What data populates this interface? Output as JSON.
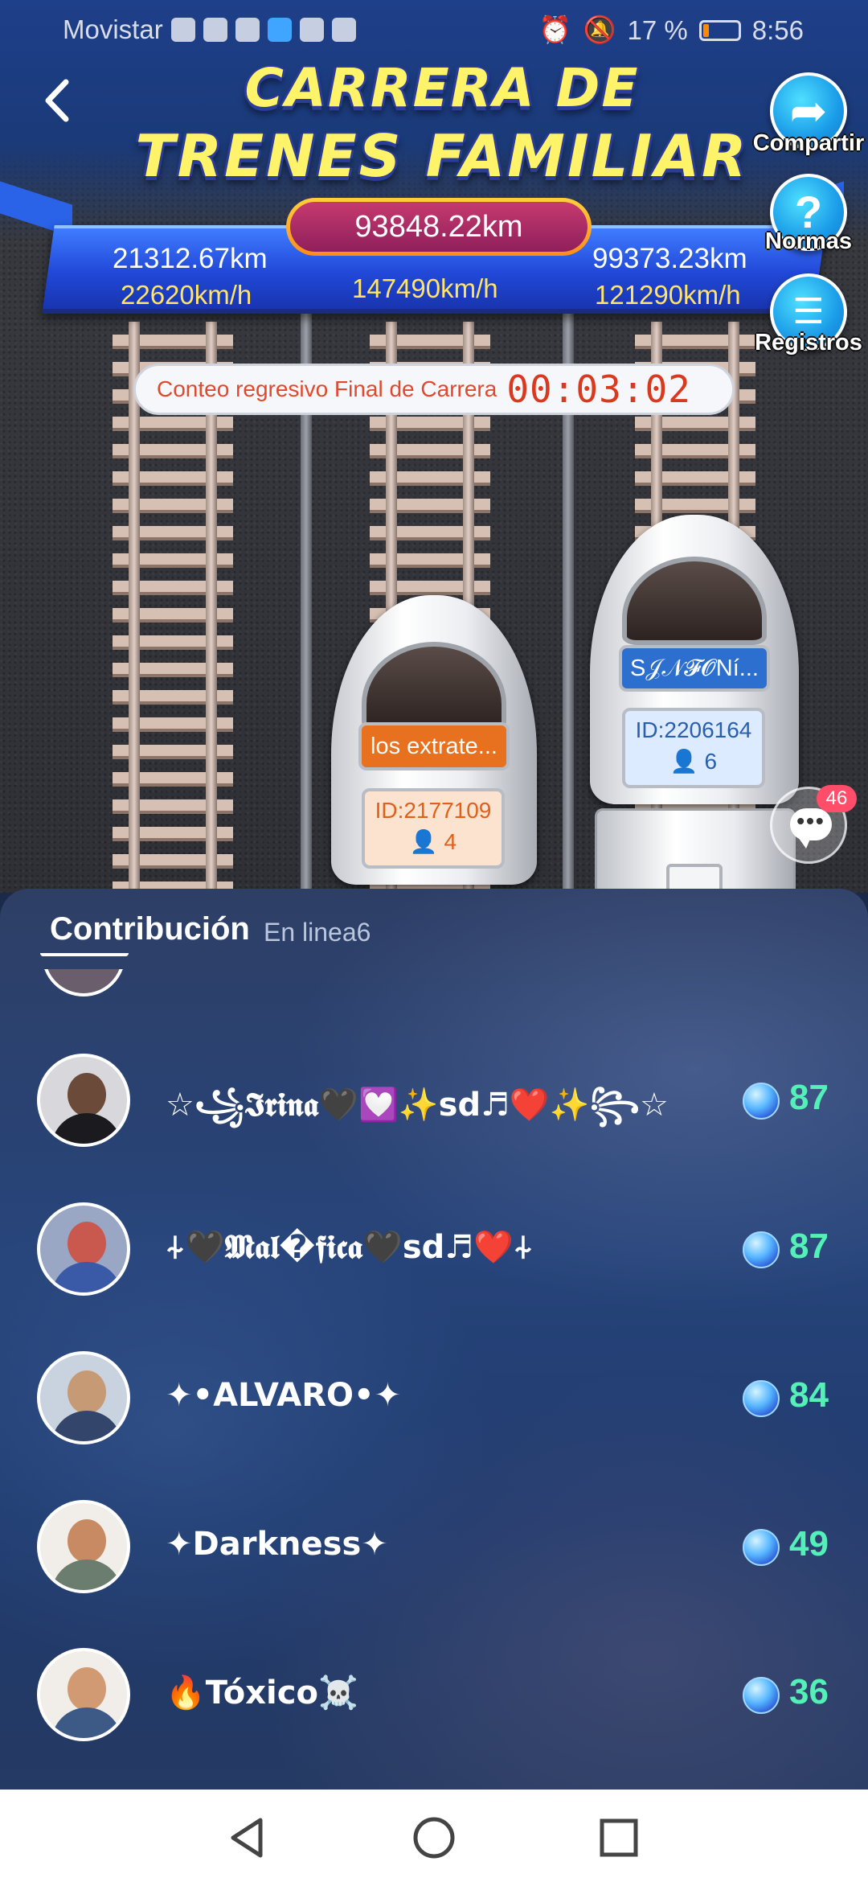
{
  "status_bar": {
    "carrier": "Movistar",
    "battery": "17 %",
    "battery_level": 0.17,
    "time": "8:56",
    "accent": "#ff8a00"
  },
  "header": {
    "title_line1": "CARRERA DE",
    "title_line2": "TRENES FAMILIAR"
  },
  "scoreboard": {
    "left_distance": "21312.67km",
    "left_speed": "22620km/h",
    "center_distance": "93848.22km",
    "center_speed": "147490km/h",
    "right_distance": "99373.23km",
    "right_speed": "121290km/h"
  },
  "countdown": {
    "label": "Conteo regresivo Final de Carrera",
    "time": "00:03:02"
  },
  "side_buttons": {
    "share": "Compartir",
    "rules": "Normas",
    "records": "Registros"
  },
  "trains": [
    {
      "name": "los extrate...",
      "id": "ID:2177109",
      "members": "4",
      "name_color": "#e8711f",
      "box_color": "#fce3cf",
      "text_color": "#e0601a"
    },
    {
      "name": "S𝒥𝒩𝓕𝓞Ní...",
      "id": "ID:2206164",
      "members": "6",
      "name_color": "#2d6fcf",
      "box_color": "#dcebff",
      "text_color": "#2a5fb0"
    }
  ],
  "chat": {
    "badge": "46"
  },
  "contribution": {
    "title": "Contribución",
    "subtitle": "En linea6",
    "rows": [
      {
        "name": "☆꧁𝕴𝖗𝖎𝖓𝖆🖤💟✨𝘀𝗱♬❤️✨꧂☆",
        "score": "87",
        "avatar_bg": "#d8d8dc",
        "avatar_head": "#6b4a3a",
        "avatar_body": "#1b1b1f"
      },
      {
        "name": "⍭🖤𝕸𝖆𝖑�𝖋𝖎𝖈𝖆🖤𝘀𝗱♬❤️⍭",
        "score": "87",
        "avatar_bg": "#9aa7c4",
        "avatar_head": "#c9584f",
        "avatar_body": "#3a5aa8"
      },
      {
        "name": "✦•ALVARO•✦",
        "score": "84",
        "avatar_bg": "#c9d3e0",
        "avatar_head": "#c69a74",
        "avatar_body": "#34456b"
      },
      {
        "name": "✦Darkness✦",
        "score": "49",
        "avatar_bg": "#f1ede8",
        "avatar_head": "#c88a63",
        "avatar_body": "#6b7d6e"
      },
      {
        "name": "🔥Tóxico☠️",
        "score": "36",
        "avatar_bg": "#f1ede8",
        "avatar_head": "#d29a73",
        "avatar_body": "#3d5a86"
      }
    ]
  }
}
